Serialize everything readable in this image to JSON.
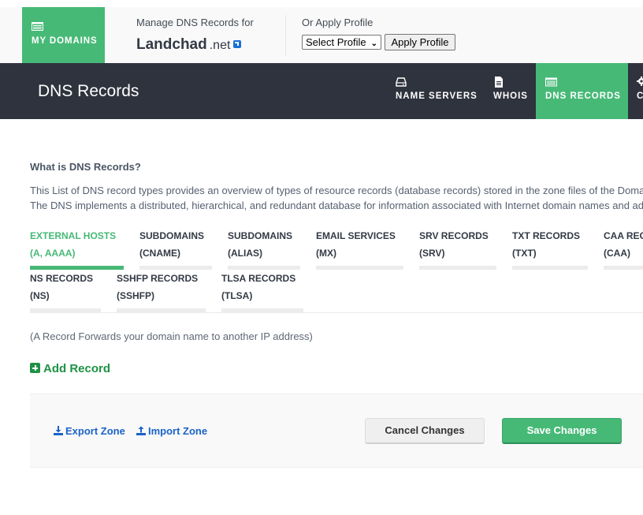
{
  "topbar": {
    "my_domains_label": "MY DOMAINS",
    "manage_label": "Manage DNS Records for",
    "domain_sld": "Landchad",
    "domain_tld": ".net",
    "profile_label": "Or Apply Profile",
    "profile_select_value": "Select Profile",
    "apply_profile_label": "Apply Profile"
  },
  "navbar": {
    "page_title": "DNS Records",
    "items": [
      {
        "label": "NAME SERVERS",
        "icon": "hard-drive-icon"
      },
      {
        "label": "WHOIS",
        "icon": "document-icon"
      },
      {
        "label": "DNS RECORDS",
        "icon": "list-icon",
        "active": true
      },
      {
        "label": "C",
        "icon": "gear-icon"
      }
    ]
  },
  "intro": {
    "title": "What is DNS Records?",
    "line1": "This List of DNS record types provides an overview of types of resource records (database records) stored in the zone files of the Doma",
    "line2": "The DNS implements a distributed, hierarchical, and redundant database for information associated with Internet domain names and ad"
  },
  "tabs": [
    {
      "line1": "EXTERNAL HOSTS",
      "line2": "(A, AAAA)",
      "active": true
    },
    {
      "line1": "SUBDOMAINS",
      "line2": "(CNAME)"
    },
    {
      "line1": "SUBDOMAINS",
      "line2": "(ALIAS)"
    },
    {
      "line1": "EMAIL SERVICES",
      "line2": "(MX)"
    },
    {
      "line1": "SRV RECORDS",
      "line2": "(SRV)"
    },
    {
      "line1": "TXT RECORDS",
      "line2": "(TXT)"
    },
    {
      "line1": "CAA RECORDS",
      "line2": "(CAA)"
    },
    {
      "line1": "NS RECORDS",
      "line2": "(NS)"
    },
    {
      "line1": "SSHFP RECORDS",
      "line2": "(SSHFP)"
    },
    {
      "line1": "TLSA RECORDS",
      "line2": "(TLSA)"
    }
  ],
  "content": {
    "record_note": "(A Record Forwards your domain name to another IP address)",
    "add_record_label": "Add Record"
  },
  "footer": {
    "export_label": "Export Zone",
    "import_label": "Import Zone",
    "cancel_label": "Cancel Changes",
    "save_label": "Save Changes"
  },
  "colors": {
    "accent_green": "#47b977",
    "nav_dark": "#2f333d",
    "link_blue": "#1b63c8",
    "add_green": "#1f9145"
  }
}
